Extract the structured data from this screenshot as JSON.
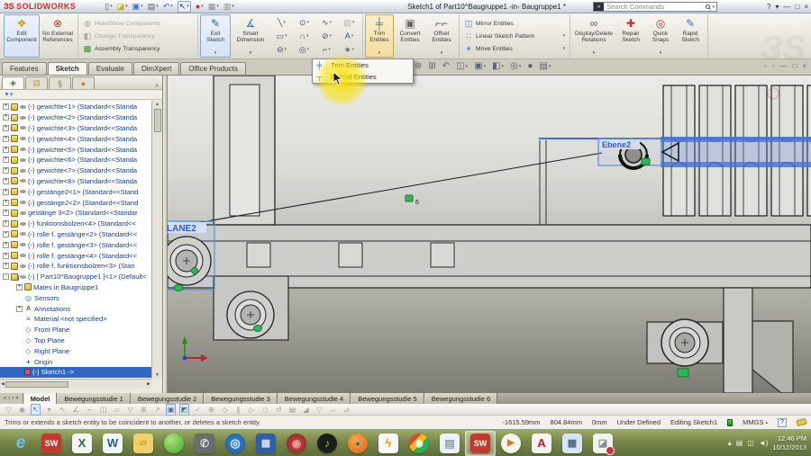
{
  "titlebar": {
    "logo_prefix": "ЗS",
    "logo": "SOLIDWORKS",
    "title": "Sketch1 of Part10^Baugruppe1 -in- Baugruppe1 *",
    "search_placeholder": "Search Commands",
    "quick_access": [
      {
        "name": "new-icon",
        "g": "▯",
        "fg": "#555",
        "arrow": true
      },
      {
        "name": "open-icon",
        "g": "◪",
        "fg": "#c9a227",
        "arrow": true
      },
      {
        "name": "save-icon",
        "g": "▣",
        "fg": "#3a6fd8",
        "arrow": true
      },
      {
        "name": "print-icon",
        "g": "▤",
        "fg": "#555",
        "arrow": true
      },
      {
        "name": "undo-icon",
        "g": "↶",
        "fg": "#3a6fd8",
        "arrow": true
      },
      {
        "name": "select-icon",
        "g": "↖",
        "fg": "#333",
        "boxed": true,
        "arrow": true
      },
      {
        "name": "rebuild-icon",
        "g": "●",
        "fg": "#c43030"
      },
      {
        "name": "file-properties-icon",
        "g": "▦",
        "fg": "#888"
      },
      {
        "name": "options-icon",
        "g": "▥",
        "fg": "#888",
        "arrow": true
      }
    ],
    "window_buttons": [
      {
        "name": "help-icon",
        "g": "?"
      },
      {
        "name": "help-arrow-icon",
        "g": "▾"
      },
      {
        "name": "minimize-icon",
        "g": "—"
      },
      {
        "name": "restore-icon",
        "g": "□"
      },
      {
        "name": "close-icon",
        "g": "×"
      }
    ]
  },
  "ribbon": {
    "edit_component": "Edit Component",
    "no_external_references": "No External References",
    "hide_show_components": "Hide/Show Components",
    "change_transparency": "Change Transparency",
    "assembly_transparency": "Assembly Transparency",
    "exit_sketch": "Exit Sketch",
    "smart_dimension": "Smart Dimension",
    "trim_entities": "Trim Entities",
    "convert_entities": "Convert Entities",
    "offset_entities": "Offset Entities",
    "mirror_entities": "Mirror Entities",
    "linear_sketch_pattern": "Linear Sketch Pattern",
    "move_entities": "Move Entities",
    "display_delete_relations": "Display/Delete Relations",
    "repair_sketch": "Repair Sketch",
    "quick_snaps": "Quick Snaps",
    "rapid_sketch": "Rapid Sketch",
    "sketch_tools": [
      {
        "name": "line-tool-icon",
        "g": "╲",
        "arrow": true
      },
      {
        "name": "circle-tool-icon",
        "g": "⊙",
        "arrow": true
      },
      {
        "name": "spline-tool-icon",
        "g": "∿",
        "arrow": true
      },
      {
        "name": "hatch-tool-icon",
        "g": "▨",
        "disabled": true
      },
      {
        "name": "rectangle-tool-icon",
        "g": "▭",
        "arrow": true
      },
      {
        "name": "arc-tool-icon",
        "g": "∩",
        "arrow": true
      },
      {
        "name": "ellipse-tool-icon",
        "g": "⊘",
        "arrow": true
      },
      {
        "name": "polygon-tool-icon",
        "g": "A"
      },
      {
        "name": "slot-tool-icon",
        "g": "⊖",
        "arrow": true
      },
      {
        "name": "perimeter-circle-tool-icon",
        "g": "◎",
        "arrow": true
      },
      {
        "name": "fillet-tool-icon",
        "g": "⌐",
        "arrow": true
      },
      {
        "name": "point-tool-icon",
        "g": "∗"
      }
    ]
  },
  "context_menu": {
    "items": [
      {
        "label": "Trim Entities",
        "glyph": "╪",
        "name": "menu-item-trim-entities"
      },
      {
        "label": "Extend Entities",
        "glyph": "┬",
        "name": "menu-item-extend-entities"
      }
    ]
  },
  "command_tabs": [
    {
      "label": "Features"
    },
    {
      "label": "Sketch",
      "active": true
    },
    {
      "label": "Evaluate"
    },
    {
      "label": "DimXpert"
    },
    {
      "label": "Office Products"
    }
  ],
  "hud_icons": [
    {
      "name": "zoom-fit-icon",
      "g": "⊕"
    },
    {
      "name": "zoom-area-icon",
      "g": "⊞"
    },
    {
      "name": "previous-view-icon",
      "g": "↶"
    },
    {
      "name": "section-view-icon",
      "g": "◫",
      "arrow": true
    },
    {
      "name": "view-orientation-icon",
      "g": "▣",
      "arrow": true
    },
    {
      "name": "display-style-icon",
      "g": "◧",
      "arrow": true
    },
    {
      "name": "hide-items-icon",
      "g": "◎",
      "arrow": true
    },
    {
      "name": "appearance-icon",
      "g": "●"
    },
    {
      "name": "scene-icon",
      "g": "▤",
      "arrow": true
    }
  ],
  "doc_window_buttons": [
    {
      "name": "doc-new-window-icon",
      "g": "▫"
    },
    {
      "name": "doc-restore-icon",
      "g": "▫"
    },
    {
      "name": "doc-minimize-icon",
      "g": "—"
    },
    {
      "name": "doc-maximize-icon",
      "g": "□"
    },
    {
      "name": "doc-close-icon",
      "g": "×"
    }
  ],
  "panel": {
    "tabs": [
      {
        "name": "featuremanager-tree-tab",
        "g": "◈",
        "fg": "#3a8a3a",
        "active": true
      },
      {
        "name": "propertymanager-tab",
        "g": "▤",
        "fg": "#c9a227"
      },
      {
        "name": "configurationmanager-tab",
        "g": "§",
        "fg": "#777"
      },
      {
        "name": "displaymanager-tab",
        "g": "●",
        "fg": "#e07820"
      }
    ],
    "more_glyph": "»",
    "filter_glyph": "▼▾"
  },
  "feature_tree": {
    "items": [
      {
        "label": "(-) gewichte<1> (Standard<<Standa",
        "icon": "part",
        "expand": "+",
        "eye": true
      },
      {
        "label": "(-) gewichte<2> (Standard<<Standa",
        "icon": "part",
        "expand": "+",
        "eye": true
      },
      {
        "label": "(-) gewichte<3> (Standard<<Standa",
        "icon": "part",
        "expand": "+",
        "eye": true
      },
      {
        "label": "(-) gewichte<4> (Standard<<Standa",
        "icon": "part",
        "expand": "+",
        "eye": true
      },
      {
        "label": "(-) gewichte<5> (Standard<<Standa",
        "icon": "part",
        "expand": "+",
        "eye": true
      },
      {
        "label": "(-) gewichte<6> (Standard<<Standa",
        "icon": "part",
        "expand": "+",
        "eye": true
      },
      {
        "label": "(-) gewichte<7> (Standard<<Standa",
        "icon": "part",
        "expand": "+",
        "eye": true
      },
      {
        "label": "(-) gewichte<8> (Standard<<Standa",
        "icon": "part",
        "expand": "+",
        "eye": true
      },
      {
        "label": "(-) gestänge2<1> (Standard<<Stand",
        "icon": "part",
        "expand": "+",
        "eye": true
      },
      {
        "label": "(-) gestänge2<2> (Standard<<Stand",
        "icon": "part",
        "expand": "+",
        "eye": true
      },
      {
        "label": "gestänge 3<2> (Standard<<Standar",
        "icon": "part",
        "expand": "+",
        "eye": true
      },
      {
        "label": "(-) funktionsbolzen<4> (Standard<<",
        "icon": "part",
        "expand": "+",
        "eye": true
      },
      {
        "label": "(-) rolle f. gestänge<2> (Standard<<",
        "icon": "part",
        "expand": "+",
        "eye": true
      },
      {
        "label": "(-) rolle f. gestänge<3> (Standard<<",
        "icon": "part",
        "expand": "+",
        "eye": true
      },
      {
        "label": "(-) rolle f. gestänge<4> (Standard<<",
        "icon": "part",
        "expand": "+",
        "eye": true
      },
      {
        "label": "(-) rolle f. funktionsbolzen<3> (Stan",
        "icon": "part",
        "expand": "+",
        "eye": true
      },
      {
        "label": "(-) [ Part10^Baugruppe1 ]<1> (Default<",
        "icon": "asm",
        "expand": "-",
        "eye": true
      },
      {
        "label": "Mates in Baugruppe1",
        "icon": "mates",
        "expand": "+",
        "level": 2
      },
      {
        "label": "Sensors",
        "icon": "sensors",
        "level": 2
      },
      {
        "label": "Annotations",
        "icon": "ann",
        "expand": "+",
        "level": 2
      },
      {
        "label": "Material <not specified>",
        "icon": "mat",
        "level": 2
      },
      {
        "label": "Front Plane",
        "icon": "plane",
        "level": 2
      },
      {
        "label": "Top Plane",
        "icon": "plane",
        "level": 2
      },
      {
        "label": "Right Plane",
        "icon": "plane",
        "level": 2
      },
      {
        "label": "Origin",
        "icon": "origin",
        "level": 2
      },
      {
        "label": "(-) Sketch1 ->",
        "icon": "sketch",
        "level": 2,
        "selected": true
      }
    ]
  },
  "viewport": {
    "left_label": "LANE2",
    "right_label": "Ebene2",
    "point_label": "6"
  },
  "bottom_tabs": {
    "nav": [
      "«",
      "‹",
      "›",
      "»"
    ],
    "items": [
      {
        "label": "Model",
        "active": true
      },
      {
        "label": "Bewegungsstudie 1"
      },
      {
        "label": "Bewegungsstudie 2"
      },
      {
        "label": "Bewegungsstudie 3"
      },
      {
        "label": "Bewegungsstudie 4"
      },
      {
        "label": "Bewegungsstudie 5"
      },
      {
        "label": "Bewegungsstudie 6"
      }
    ]
  },
  "mini_toolbar": [
    {
      "g": "▽"
    },
    {
      "g": "◉"
    },
    {
      "g": "↖",
      "boxed": true
    },
    {
      "g": "▾"
    },
    {
      "g": "↖"
    },
    {
      "g": "∠"
    },
    {
      "g": "⌐"
    },
    {
      "g": "◫"
    },
    {
      "g": "▱"
    },
    {
      "g": "▽"
    },
    {
      "g": "⊞"
    },
    {
      "g": "↗"
    },
    {
      "g": "▣",
      "boxed": true
    },
    {
      "g": "◩",
      "boxed": true
    },
    {
      "g": "✓"
    },
    {
      "g": "⊕"
    },
    {
      "g": "◇"
    },
    {
      "g": "∥"
    },
    {
      "g": "▷"
    },
    {
      "g": "◻"
    },
    {
      "g": "↺"
    },
    {
      "g": "▤"
    },
    {
      "g": "◢"
    },
    {
      "g": "▽"
    },
    {
      "g": "↔"
    },
    {
      "g": "⊿"
    }
  ],
  "statusbar": {
    "message": "Trims or extends a sketch entity to be coincident to another, or deletes a sketch entity.",
    "coord_x": "-1615.59mm",
    "coord_y": "804.84mm",
    "coord_z": "0mm",
    "definition_state": "Under Defined",
    "mode": "Editing Sketch1",
    "units": "MMGS"
  },
  "taskbar": {
    "time": "12:46 PM",
    "date": "10/12/2013",
    "tray_glyphs": {
      "overflow": "▴",
      "tray1": "▤",
      "tray2": "◫",
      "speaker": "◄)"
    },
    "items": [
      {
        "name": "taskbar-internet-explorer",
        "g": "e",
        "fg": "#6ac4f2",
        "bg": "transparent",
        "fs": "19px",
        "italic": true,
        "flat": true
      },
      {
        "name": "taskbar-solidworks",
        "g": "SW",
        "fg": "#fff",
        "bg": "#c23a2e",
        "fs": "9px"
      },
      {
        "name": "taskbar-excel",
        "g": "X",
        "fg": "#1e7145",
        "bg": "#f4f6f2",
        "fs": "13px"
      },
      {
        "name": "taskbar-word",
        "g": "W",
        "fg": "#2b579a",
        "bg": "#f2f5fa",
        "fs": "13px"
      },
      {
        "name": "taskbar-explorer-folder",
        "g": "▱",
        "fg": "#b8922e",
        "bg": "#f2cf6b",
        "fs": "10px"
      },
      {
        "name": "taskbar-green-orb",
        "g": "",
        "fg": "#fff",
        "bg": "radial-gradient(circle at 35% 30%,#a5e87a,#4ca32c)",
        "circle": true
      },
      {
        "name": "taskbar-phone",
        "g": "✆",
        "fg": "#ddd",
        "bg": "#6b6b6b",
        "fs": "12px"
      },
      {
        "name": "taskbar-blue-disc",
        "g": "◎",
        "fg": "#dff0ff",
        "bg": "radial-gradient(circle,#3a8ade,#145a9e)",
        "circle": true,
        "fs": "13px"
      },
      {
        "name": "taskbar-media-tile",
        "g": "▦",
        "fg": "#cfe0f5",
        "bg": "#2f5fa8",
        "fs": "11px"
      },
      {
        "name": "taskbar-red-disc",
        "g": "◉",
        "fg": "#e89a9a",
        "bg": "radial-gradient(circle,#c04848,#8e2222)",
        "circle": true,
        "fs": "12px"
      },
      {
        "name": "taskbar-itunes",
        "g": "♪",
        "fg": "#7ed957",
        "bg": "#1c1c1c",
        "circle": true,
        "fs": "12px"
      },
      {
        "name": "taskbar-firefox",
        "g": "●",
        "fg": "#3a5fae",
        "bg": "radial-gradient(circle at 40% 35%,#f5a54a,#d96414)",
        "circle": true,
        "fs": "9px"
      },
      {
        "name": "taskbar-messenger",
        "g": "ϟ",
        "fg": "#e8a020",
        "bg": "#f7f7f7",
        "fs": "13px"
      },
      {
        "name": "taskbar-chrome",
        "g": "◉",
        "fg": "#fff",
        "bg": "linear-gradient(135deg,#ea4335 32%,#fbbc05 32% 55%,#34a853 55%)",
        "circle": true,
        "fs": "11px"
      },
      {
        "name": "taskbar-notepad",
        "g": "▤",
        "fg": "#8a9ab0",
        "bg": "#eef2f8",
        "fs": "12px"
      },
      {
        "name": "taskbar-solidworks-active",
        "g": "SW",
        "fg": "#fff",
        "bg": "#c23a2e",
        "fs": "9px",
        "active": true
      },
      {
        "name": "taskbar-media-player",
        "g": "▶",
        "fg": "#e07820",
        "bg": "#f4f3ec",
        "circle": true,
        "fs": "10px"
      },
      {
        "name": "taskbar-adobe-reader",
        "g": "A",
        "fg": "#c01818",
        "bg": "#f7f5f3",
        "fs": "13px"
      },
      {
        "name": "taskbar-calculator",
        "g": "▦",
        "fg": "#4a6a8a",
        "bg": "#d5e5f2",
        "fs": "11px"
      },
      {
        "name": "taskbar-photo-viewer",
        "g": "◪",
        "fg": "#8a8a8a",
        "bg": "#f2f2f0",
        "fs": "11px",
        "badge": true
      }
    ]
  }
}
